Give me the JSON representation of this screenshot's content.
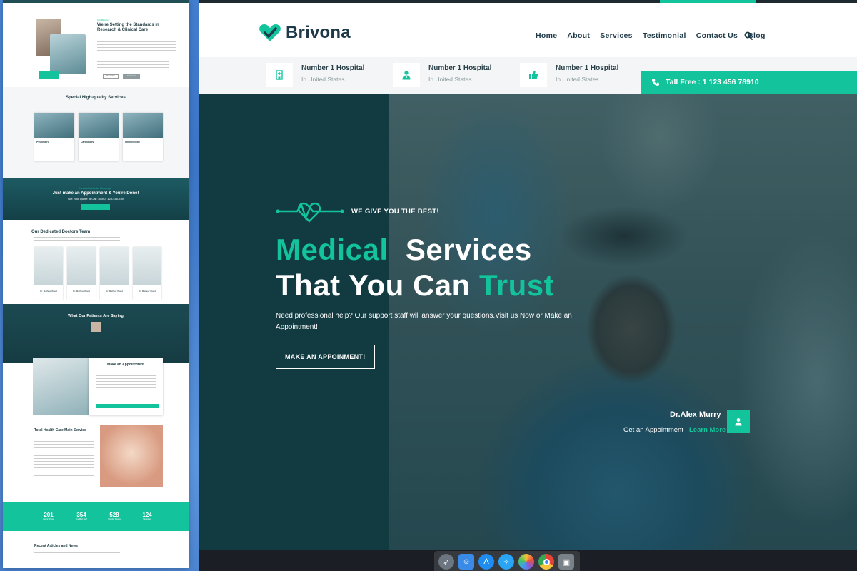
{
  "preview": {
    "about_eyebrow": "Our Mission",
    "about_title": "We're Setting the Standards in Research & Clinical Care",
    "about_btn1": "Read More",
    "about_btn2": "Contact Us",
    "services_title": "Special High-quality Services",
    "service_cards": [
      "Psychiatry",
      "Cardiology",
      "Immunology"
    ],
    "cta_eyebrow": "Need a Doctor for Check-up?",
    "cta_title": "Just make an Appointment & You're Done!",
    "cta_sub": "Get Your Quote or Call: (0080) 123-456-789",
    "team_title": "Our Dedicated Doctors Team",
    "doctors": [
      "Dr. Mathew Wood",
      "Dr. Mathew Wood",
      "Dr. Mathew Wood",
      "Dr. Mathew Wood"
    ],
    "testimonial_title": "What Our Patients Are Saying",
    "appointment_title": "Make an Appointment",
    "care_title": "Total Health Care Main Service",
    "stats": [
      {
        "value": "201",
        "label": "Award Winner"
      },
      {
        "value": "354",
        "label": "Qualified Staff"
      },
      {
        "value": "528",
        "label": "Hospital Rooms"
      },
      {
        "value": "124",
        "label": "Medicines"
      }
    ],
    "news_title": "Recent Articles and News"
  },
  "brand": {
    "name": "Brivona",
    "accent": "#13c39b",
    "dark": "#1e3a48"
  },
  "nav": {
    "items": [
      "Home",
      "About",
      "Services",
      "Testimonial",
      "Contact Us",
      "Blog"
    ]
  },
  "info": [
    {
      "title": "Number 1 Hospital",
      "sub": "In United States",
      "icon": "hospital-icon"
    },
    {
      "title": "Number 1 Hospital",
      "sub": "In United States",
      "icon": "doctor-icon"
    },
    {
      "title": "Number 1 Hospital",
      "sub": "In United States",
      "icon": "thumbs-up-icon"
    }
  ],
  "tollfree": "Tall Free : 1 123 456 78910",
  "hero": {
    "tagline": "WE GIVE YOU THE BEST!",
    "headline_1a": "Medical",
    "headline_1b": "Services",
    "headline_2a": "That You Can",
    "headline_2b": "Trust",
    "description": "Need professional help? Our support staff will answer your questions.Visit us Now or Make an Appointment!",
    "cta": "MAKE AN APPOINMENT!",
    "doctor_name": "Dr.Alex Murry",
    "doctor_appt": "Get an Appointment",
    "doctor_link": "Learn More"
  },
  "dock": {
    "apps": [
      "launchpad-icon",
      "finder-icon",
      "app-store-icon",
      "safari-icon",
      "photos-icon",
      "chrome-icon",
      "preview-icon"
    ]
  }
}
